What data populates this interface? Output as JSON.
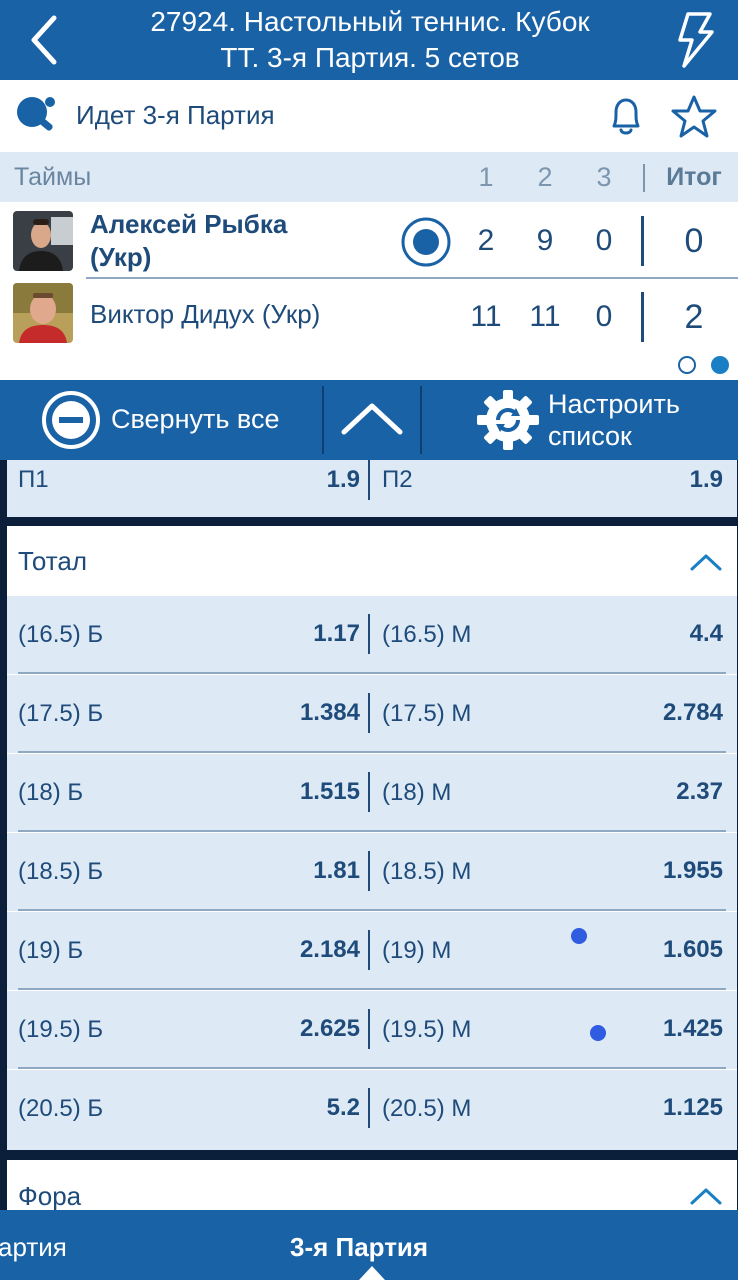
{
  "header": {
    "title_line1": "27924. Настольный теннис. Кубок",
    "title_line2": "ТТ. 3-я  Партия. 5 сетов"
  },
  "status": {
    "text": "Идет 3-я  Партия"
  },
  "scoreboard": {
    "label": "Таймы",
    "columns": [
      "1",
      "2",
      "3"
    ],
    "total_label": "Итог",
    "players": [
      {
        "name_line1": "Алексей Рыбка",
        "name_line2": "(Укр)",
        "scores": [
          "2",
          "9",
          "0"
        ],
        "total": "0",
        "serving": true
      },
      {
        "name": "Виктор Дидух (Укр)",
        "scores": [
          "11",
          "11",
          "0"
        ],
        "total": "2",
        "serving": false
      }
    ],
    "pages": 2,
    "active_page": 2
  },
  "toolbar": {
    "collapse_label": "Свернуть все",
    "settings_line1": "Настроить",
    "settings_line2": "список"
  },
  "markets": {
    "winner": {
      "left_label": "П1",
      "left_value": "1.9",
      "right_label": "П2",
      "right_value": "1.9"
    },
    "total": {
      "title": "Тотал",
      "rows": [
        {
          "over_label": "(16.5) Б",
          "over_value": "1.17",
          "under_label": "(16.5) М",
          "under_value": "4.4",
          "under_marker": false
        },
        {
          "over_label": "(17.5) Б",
          "over_value": "1.384",
          "under_label": "(17.5) М",
          "under_value": "2.784",
          "under_marker": false
        },
        {
          "over_label": "(18) Б",
          "over_value": "1.515",
          "under_label": "(18) М",
          "under_value": "2.37",
          "under_marker": false
        },
        {
          "over_label": "(18.5) Б",
          "over_value": "1.81",
          "under_label": "(18.5) М",
          "under_value": "1.955",
          "under_marker": false
        },
        {
          "over_label": "(19) Б",
          "over_value": "2.184",
          "under_label": "(19) М",
          "under_value": "1.605",
          "under_marker": true
        },
        {
          "over_label": "(19.5) Б",
          "over_value": "2.625",
          "under_label": "(19.5) М",
          "under_value": "1.425",
          "under_marker": true
        },
        {
          "over_label": "(20.5) Б",
          "over_value": "5.2",
          "under_label": "(20.5) М",
          "under_value": "1.125",
          "under_marker": false
        }
      ]
    },
    "handicap": {
      "title": "Фора"
    }
  },
  "tabs": {
    "prev_label": "артия",
    "current_label": "3-я  Партия"
  },
  "colors": {
    "brand_blue": "#1a62a6",
    "text_navy": "#1e4b7a",
    "row_bg": "#dde9f5",
    "marker_blue": "#2f5ce0",
    "background_dark": "#0b1e3a"
  },
  "icons": [
    "back-chevron-icon",
    "lightning-icon",
    "table-tennis-icon",
    "bell-icon",
    "star-icon",
    "serve-indicator-icon",
    "collapse-all-icon",
    "chevron-up-icon",
    "settings-gear-icon"
  ]
}
